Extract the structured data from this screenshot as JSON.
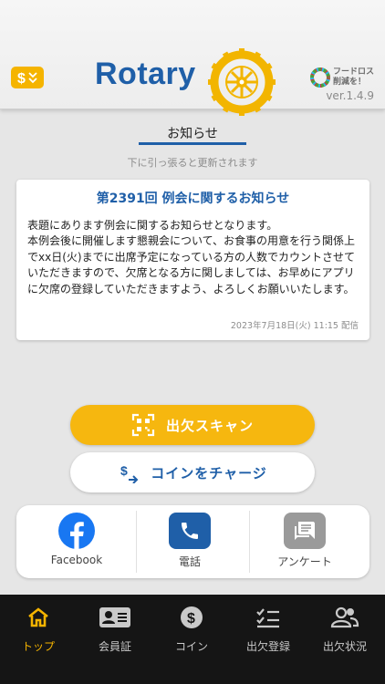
{
  "header": {
    "brand": "Rotary",
    "sdg_text_line1": "フードロス",
    "sdg_text_line2": "削減を！",
    "version": "ver.1.4.9",
    "accent": "#1f5fa8",
    "coin_icon": "coin-icon"
  },
  "notice": {
    "title": "お知らせ",
    "pull_hint": "下に引っ張ると更新されます",
    "card": {
      "title": "第2391回 例会に関するお知らせ",
      "body": "表題にあります例会に関するお知らせとなります。\n本例会後に開催します懇親会について、お食事の用意を行う関係上でxx日(火)までに出席予定になっている方の人数でカウントさせていただきますので、欠席となる方に関しましては、お早めにアプリに欠席の登録していただきますよう、よろしくお願いいたします。",
      "date": "2023年7月18日(火) 11:15 配信"
    }
  },
  "actions": {
    "scan_label": "出欠スキャン",
    "charge_label": "コインをチャージ",
    "scan_color": "#f6b70f"
  },
  "shortcuts": [
    {
      "label": "Facebook",
      "icon": "facebook-icon",
      "color": "#1877f2"
    },
    {
      "label": "電話",
      "icon": "phone-icon",
      "color": "#1f5fa8"
    },
    {
      "label": "アンケート",
      "icon": "survey-icon",
      "color": "#9a9a9a"
    }
  ],
  "tabs": [
    {
      "label": "トップ",
      "icon": "home-icon",
      "active": true
    },
    {
      "label": "会員証",
      "icon": "member-card-icon",
      "active": false
    },
    {
      "label": "コイン",
      "icon": "coin-icon",
      "active": false
    },
    {
      "label": "出欠登録",
      "icon": "attendance-register-icon",
      "active": false
    },
    {
      "label": "出欠状況",
      "icon": "attendance-status-icon",
      "active": false
    }
  ]
}
